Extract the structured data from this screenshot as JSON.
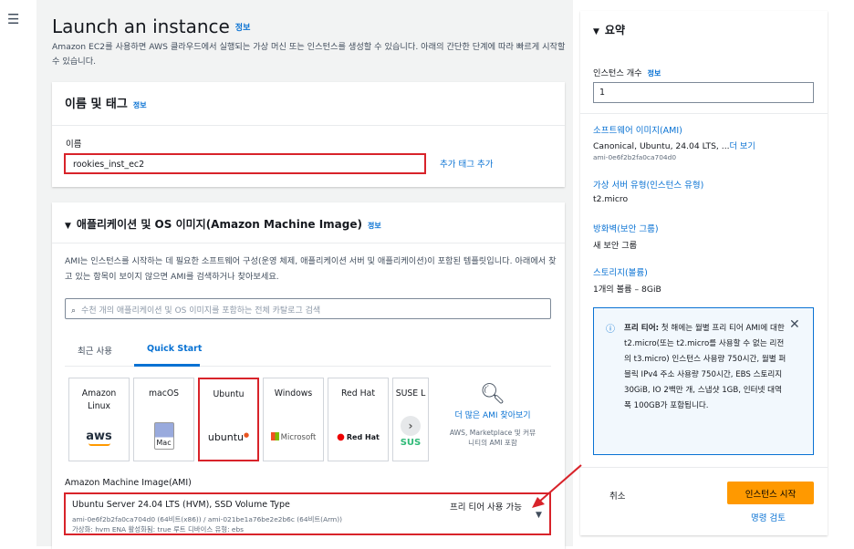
{
  "nav": {
    "menu_icon": "☰"
  },
  "page": {
    "title": "Launch an instance",
    "title_info": "정보",
    "description": "Amazon EC2를 사용하면 AWS 클라우드에서 실행되는 가상 머신 또는 인스턴스를 생성할 수 있습니다. 아래의 간단한 단계에 따라 빠르게 시작할 수 있습니다."
  },
  "name_tags": {
    "header": "이름 및 태그",
    "info": "정보",
    "name_label": "이름",
    "name_value": "rookies_inst_ec2",
    "add_tag": "추가 태그 추가"
  },
  "ami": {
    "header": "애플리케이션 및 OS 이미지(Amazon Machine Image)",
    "info": "정보",
    "description": "AMI는 인스턴스를 시작하는 데 필요한 소프트웨어 구성(운영 체제, 애플리케이션 서버 및 애플리케이션)이 포함된 템플릿입니다. 아래에서 찾고 있는 항목이 보이지 않으면 AMI를 검색하거나 찾아보세요.",
    "search_placeholder": "수천 개의 애플리케이션 및 OS 이미지를 포함하는 전체 카탈로그 검색",
    "tabs": [
      "최근 사용",
      "Quick Start"
    ],
    "tiles": [
      {
        "name": "Amazon Linux",
        "logo": "aws"
      },
      {
        "name": "macOS",
        "logo": "Mac"
      },
      {
        "name": "Ubuntu",
        "logo": "ubuntu"
      },
      {
        "name": "Windows",
        "logo": "Microsoft"
      },
      {
        "name": "Red Hat",
        "logo": "Red Hat"
      },
      {
        "name": "SUSE L",
        "logo": "SUS"
      }
    ],
    "more_link": "더 많은 AMI 찾아보기",
    "more_sub": "AWS, Marketplace 및 커뮤니티의 AMI 포함",
    "select_label": "Amazon Machine Image(AMI)",
    "selected_title": "Ubuntu Server 24.04 LTS (HVM), SSD Volume Type",
    "free_tier": "프리 티어 사용 가능",
    "selected_ids": "ami-0e6f2b2fa0ca704d0 (64비트(x86)) / ami-021be1a76be2e2b6c (64비트(Arm))",
    "selected_attrs": "가상화: hvm    ENA 활성화됨: true    루트 디바이스 유형: ebs"
  },
  "summary": {
    "title": "요약",
    "instance_count_label": "인스턴스 개수",
    "instance_count_info": "정보",
    "instance_count": "1",
    "software_image_label": "소프트웨어 이미지(AMI)",
    "software_image_value": "Canonical, Ubuntu, 24.04 LTS, ...",
    "software_image_more": "더 보기",
    "software_image_id": "ami-0e6f2b2fa0ca704d0",
    "server_type_label": "가상 서버 유형(인스턴스 유형)",
    "server_type_value": "t2.micro",
    "firewall_label": "방화벽(보안 그룹)",
    "firewall_value": "새 보안 그룹",
    "storage_label": "스토리지(볼륨)",
    "storage_value": "1개의 볼륨 – 8GiB",
    "alert_title": "프리 티어:",
    "alert_text": "첫 해에는 월별 프리 티어 AMI에 대한 t2.micro(또는 t2.micro를 사용할 수 없는 리전의 t3.micro) 인스턴스 사용량 750시간, 월별 퍼블릭 IPv4 주소 사용량 750시간, EBS 스토리지 30GiB, IO 2백만 개, 스냅샷 1GB, 인터넷 대역폭 100GB가 포함됩니다.",
    "cancel": "취소",
    "launch": "인스턴스 시작",
    "review": "명령 검토"
  },
  "colors": {
    "accent": "#0972d3",
    "launch": "#ff9900",
    "highlight": "#d8232a"
  }
}
